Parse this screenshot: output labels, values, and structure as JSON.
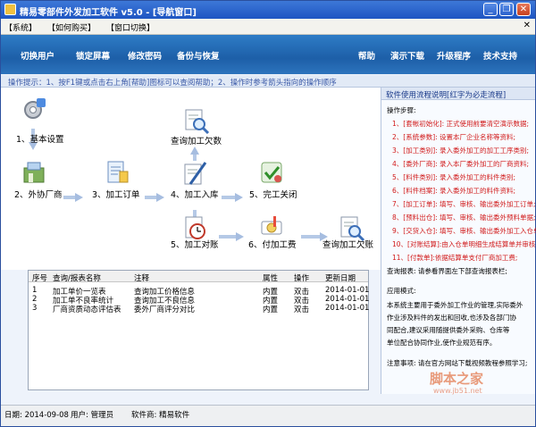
{
  "window": {
    "title": "精易零部件外发加工软件 v5.0 - [导航窗口]",
    "buttons": [
      "_",
      "❐",
      "✕"
    ]
  },
  "menubar": {
    "items": [
      "【系统】",
      "【如何购买】",
      "【窗口切换】"
    ],
    "close": "✕"
  },
  "toolbar": {
    "left": [
      "切换用户",
      "锁定屏幕",
      "修改密码",
      "备份与恢复"
    ],
    "right": [
      "帮助",
      "演示下载",
      "升级程序",
      "技术支持"
    ]
  },
  "tip": "操作提示：1、按F1键或点击右上角[帮助]图标可以查阅帮助；2、操作时参考箭头指向的操作顺序",
  "flow": {
    "nodes": [
      {
        "label": "1、基本设置",
        "icon": "settings-icon"
      },
      {
        "label": "查询加工欠数",
        "icon": "magnifier-icon"
      },
      {
        "label": "2、外协厂商",
        "icon": "factory-icon"
      },
      {
        "label": "3、加工订单",
        "icon": "order-icon"
      },
      {
        "label": "4、加工入库",
        "icon": "warehouse-icon"
      },
      {
        "label": "5、完工关闭",
        "icon": "checkmark-icon"
      },
      {
        "label": "5、加工对账",
        "icon": "clock-icon"
      },
      {
        "label": "6、付加工费",
        "icon": "money-icon"
      },
      {
        "label": "查询加工欠账",
        "icon": "magnifier-icon"
      }
    ]
  },
  "grid": {
    "columns": [
      "序号",
      "查询/报表名称",
      "注释",
      "属性",
      "操作",
      "更新日期"
    ],
    "rows": [
      [
        "1",
        "加工单价一览表",
        "查询加工价格信息",
        "内置",
        "双击",
        "2014-01-01"
      ],
      [
        "2",
        "加工单不良率统计",
        "查询加工不良信息",
        "内置",
        "双击",
        "2014-01-01"
      ],
      [
        "3",
        "厂商资质动态评估表",
        "委外厂商评分对比",
        "内置",
        "双击",
        "2014-01-01"
      ]
    ]
  },
  "side": {
    "header": "软件使用流程说明[红字为必走流程]",
    "steps_title": "操作步骤:",
    "steps": [
      "1、[套帐初始化]: 正式使用前要清空演示数据;",
      "2、[系统参数]: 设置本厂企业名称等资料;",
      "3、[加工类别]: 录入委外加工的加工工序类别;",
      "4、[委外厂商]: 录入本厂委外加工的厂商资料;",
      "5、[料件类别]: 录入委外加工的料件类别;",
      "6、[料件档案]: 录入委外加工的料件资料;",
      "7、[加工订单]: 填写、审核、输出委外加工订单;",
      "8、[预料出仓]: 填写、审核、输出委外预料单据;",
      "9、[交货入仓]: 填写、审核、输出委外加工入仓单;",
      "10、[对账结算]:由入仓单明细生成结算单并审核;",
      "11、[付款单]:依据结算单支付厂商加工费;"
    ],
    "report_line": "查询报表: 请参看界面左下部查询报表栏;",
    "app_title": "应用模式:",
    "app_lines": [
      "本系统主要用于委外加工作业的管理,实际委外",
      "作业涉及料件的发出和回收,也涉及各部门协",
      "同配合,建议采用随提供委外采购、仓库等",
      "单位配合协同作业,使作业规范有序。"
    ],
    "note": "注意事项: 请在官方网站下载视频教程参照学习;"
  },
  "watermark": {
    "big": "脚本之家",
    "small": "www.jb51.net"
  },
  "status": {
    "date": "日期: 2014-09-08",
    "user": "用户: 管理员",
    "vendor": "软件商: 精易软件"
  }
}
